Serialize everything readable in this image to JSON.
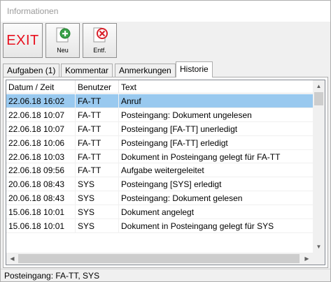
{
  "window": {
    "title": "Informationen"
  },
  "toolbar": {
    "exit_label": "EXIT",
    "new_label": "Neu",
    "delete_label": "Entf.",
    "colors": {
      "exit": "#e8101e",
      "new_icon": "#3aa14a",
      "delete_icon": "#d8202a"
    }
  },
  "tabs": [
    {
      "label": "Aufgaben (1)",
      "active": false
    },
    {
      "label": "Kommentar",
      "active": false
    },
    {
      "label": "Anmerkungen",
      "active": false
    },
    {
      "label": "Historie",
      "active": true
    }
  ],
  "grid": {
    "columns": [
      "Datum / Zeit",
      "Benutzer",
      "Text"
    ],
    "rows": [
      {
        "date": "22.06.18 16:02",
        "user": "FA-TT",
        "text": "Anruf",
        "selected": true
      },
      {
        "date": "22.06.18 10:07",
        "user": "FA-TT",
        "text": "Posteingang: Dokument ungelesen"
      },
      {
        "date": "22.06.18 10:07",
        "user": "FA-TT",
        "text": "Posteingang [FA-TT] unerledigt"
      },
      {
        "date": "22.06.18 10:06",
        "user": "FA-TT",
        "text": "Posteingang [FA-TT] erledigt"
      },
      {
        "date": "22.06.18 10:03",
        "user": "FA-TT",
        "text": "Dokument in Posteingang gelegt für FA-TT"
      },
      {
        "date": "22.06.18 09:56",
        "user": "FA-TT",
        "text": "Aufgabe weitergeleitet"
      },
      {
        "date": "20.06.18 08:43",
        "user": "SYS",
        "text": "Posteingang [SYS] erledigt"
      },
      {
        "date": "20.06.18 08:43",
        "user": "SYS",
        "text": "Posteingang: Dokument gelesen"
      },
      {
        "date": "15.06.18 10:01",
        "user": "SYS",
        "text": "Dokument angelegt"
      },
      {
        "date": "15.06.18 10:01",
        "user": "SYS",
        "text": "Dokument in Posteingang gelegt für SYS"
      }
    ],
    "selected_color": "#99c9ef"
  },
  "status": {
    "text": "Posteingang: FA-TT, SYS"
  }
}
